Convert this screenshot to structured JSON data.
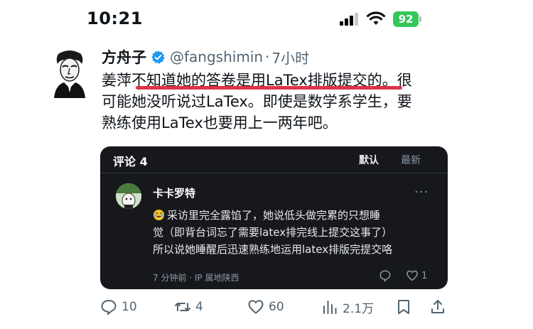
{
  "status_bar": {
    "time": "10:21",
    "battery": "92",
    "battery_color": "#34c759"
  },
  "tweet": {
    "author_name": "方舟子",
    "handle": "@fangshimin",
    "separator": "·",
    "time_ago": "7小时",
    "verified_color": "#1d9bf0",
    "text_lines": [
      "姜萍不知道她的答卷是用LaTex排版提交的。很",
      "可能她没听说过LaTex。即使是数学系学生，要",
      "熟练使用LaTex也要用上一两年吧。"
    ],
    "highlight_color": "#e0334a"
  },
  "comments_card": {
    "title": "评论 4",
    "sort_default": "默认",
    "sort_latest": "最新",
    "comment": {
      "author": "卡卡罗特",
      "more_icon": "more-horizontal-icon",
      "emoji_icon": "crying-laughing-emoji-icon",
      "text_lines": [
        "采访里完全露馅了，她说低头做完累的只想睡",
        "觉（即背台词忘了需要latex排完线上提交这事了）",
        "所以说她睡醒后迅速熟练地运用latex排版完提交咯"
      ],
      "meta": "7 分钟前 · IP 属地陕西",
      "like_count": "1"
    }
  },
  "actions": {
    "reply_count": "10",
    "retweet_count": "4",
    "like_count": "60",
    "views_count": "2.1万"
  }
}
